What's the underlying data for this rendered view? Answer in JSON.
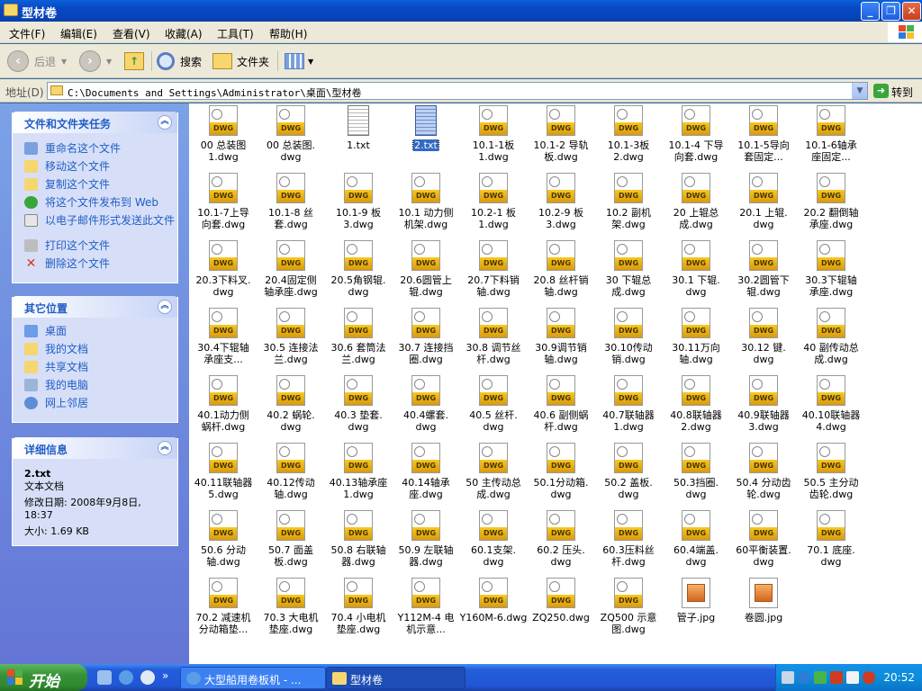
{
  "window": {
    "title": "型材卷",
    "buttons": {
      "minimize": "_",
      "maximize": "❐",
      "close": "✕"
    }
  },
  "menu": [
    "文件(F)",
    "编辑(E)",
    "查看(V)",
    "收藏(A)",
    "工具(T)",
    "帮助(H)"
  ],
  "toolbar": {
    "back": "后退",
    "search": "搜索",
    "folders": "文件夹"
  },
  "address": {
    "label": "地址(D)",
    "path": "C:\\Documents and Settings\\Administrator\\桌面\\型材卷",
    "go": "转到"
  },
  "panels": {
    "tasks": {
      "title": "文件和文件夹任务",
      "items": [
        "重命名这个文件",
        "移动这个文件",
        "复制这个文件",
        "将这个文件发布到 Web",
        "以电子邮件形式发送此文件",
        "打印这个文件",
        "删除这个文件"
      ]
    },
    "places": {
      "title": "其它位置",
      "items": [
        "桌面",
        "我的文档",
        "共享文档",
        "我的电脑",
        "网上邻居"
      ]
    },
    "details": {
      "title": "详细信息",
      "name": "2.txt",
      "type": "文本文档",
      "modified": "修改日期: 2008年9月8日, 18:37",
      "size": "大小: 1.69 KB"
    }
  },
  "files": [
    {
      "name": "00 总装图\n1.dwg",
      "type": "dwg"
    },
    {
      "name": "00 总装图.\ndwg",
      "type": "dwg"
    },
    {
      "name": "1.txt",
      "type": "txt"
    },
    {
      "name": "2.txt",
      "type": "txt",
      "selected": true
    },
    {
      "name": "10.1-1板\n1.dwg",
      "type": "dwg"
    },
    {
      "name": "10.1-2 导轨\n板.dwg",
      "type": "dwg"
    },
    {
      "name": "10.1-3板\n2.dwg",
      "type": "dwg"
    },
    {
      "name": "10.1-4 下导\n向套.dwg",
      "type": "dwg"
    },
    {
      "name": "10.1-5导向\n套固定...",
      "type": "dwg"
    },
    {
      "name": "10.1-6轴承\n座固定...",
      "type": "dwg"
    },
    {
      "name": "10.1-7上导\n向套.dwg",
      "type": "dwg"
    },
    {
      "name": "10.1-8 丝\n套.dwg",
      "type": "dwg"
    },
    {
      "name": "10.1-9 板\n3.dwg",
      "type": "dwg"
    },
    {
      "name": "10.1 动力侧\n机架.dwg",
      "type": "dwg"
    },
    {
      "name": "10.2-1 板\n1.dwg",
      "type": "dwg"
    },
    {
      "name": "10.2-9 板\n3.dwg",
      "type": "dwg"
    },
    {
      "name": "10.2 副机\n架.dwg",
      "type": "dwg"
    },
    {
      "name": "20 上辊总\n成.dwg",
      "type": "dwg"
    },
    {
      "name": "20.1 上辊.\ndwg",
      "type": "dwg"
    },
    {
      "name": "20.2 翻倒轴\n承座.dwg",
      "type": "dwg"
    },
    {
      "name": "20.3下料叉.\ndwg",
      "type": "dwg"
    },
    {
      "name": "20.4固定侧\n轴承座.dwg",
      "type": "dwg"
    },
    {
      "name": "20.5角钢辊.\ndwg",
      "type": "dwg"
    },
    {
      "name": "20.6圆管上\n辊.dwg",
      "type": "dwg"
    },
    {
      "name": "20.7下料销\n轴.dwg",
      "type": "dwg"
    },
    {
      "name": "20.8 丝杆销\n轴.dwg",
      "type": "dwg"
    },
    {
      "name": "30 下辊总\n成.dwg",
      "type": "dwg"
    },
    {
      "name": "30.1 下辊.\ndwg",
      "type": "dwg"
    },
    {
      "name": "30.2圆管下\n辊.dwg",
      "type": "dwg"
    },
    {
      "name": "30.3下辊轴\n承座.dwg",
      "type": "dwg"
    },
    {
      "name": "30.4下辊轴\n承座支...",
      "type": "dwg"
    },
    {
      "name": "30.5 连接法\n兰.dwg",
      "type": "dwg"
    },
    {
      "name": "30.6 套筒法\n兰.dwg",
      "type": "dwg"
    },
    {
      "name": "30.7 连接挡\n圈.dwg",
      "type": "dwg"
    },
    {
      "name": "30.8 调节丝\n杆.dwg",
      "type": "dwg"
    },
    {
      "name": "30.9调节销\n轴.dwg",
      "type": "dwg"
    },
    {
      "name": "30.10传动\n销.dwg",
      "type": "dwg"
    },
    {
      "name": "30.11万向\n轴.dwg",
      "type": "dwg"
    },
    {
      "name": "30.12 键.\ndwg",
      "type": "dwg"
    },
    {
      "name": "40 副传动总\n成.dwg",
      "type": "dwg"
    },
    {
      "name": "40.1动力侧\n蜗杆.dwg",
      "type": "dwg"
    },
    {
      "name": "40.2 蜗轮.\ndwg",
      "type": "dwg"
    },
    {
      "name": "40.3 垫套.\ndwg",
      "type": "dwg"
    },
    {
      "name": "40.4螺套.\ndwg",
      "type": "dwg"
    },
    {
      "name": "40.5 丝杆.\ndwg",
      "type": "dwg"
    },
    {
      "name": "40.6 副侧蜗\n杆.dwg",
      "type": "dwg"
    },
    {
      "name": "40.7联轴器\n1.dwg",
      "type": "dwg"
    },
    {
      "name": "40.8联轴器\n2.dwg",
      "type": "dwg"
    },
    {
      "name": "40.9联轴器\n3.dwg",
      "type": "dwg"
    },
    {
      "name": "40.10联轴器\n4.dwg",
      "type": "dwg"
    },
    {
      "name": "40.11联轴器\n5.dwg",
      "type": "dwg"
    },
    {
      "name": "40.12传动\n轴.dwg",
      "type": "dwg"
    },
    {
      "name": "40.13轴承座\n1.dwg",
      "type": "dwg"
    },
    {
      "name": "40.14轴承\n座.dwg",
      "type": "dwg"
    },
    {
      "name": "50 主传动总\n成.dwg",
      "type": "dwg"
    },
    {
      "name": "50.1分动箱.\ndwg",
      "type": "dwg"
    },
    {
      "name": "50.2 盖板.\ndwg",
      "type": "dwg"
    },
    {
      "name": "50.3挡圈.\ndwg",
      "type": "dwg"
    },
    {
      "name": "50.4 分动齿\n轮.dwg",
      "type": "dwg"
    },
    {
      "name": "50.5 主分动\n齿轮.dwg",
      "type": "dwg"
    },
    {
      "name": "50.6 分动\n轴.dwg",
      "type": "dwg"
    },
    {
      "name": "50.7 面盖\n板.dwg",
      "type": "dwg"
    },
    {
      "name": "50.8 右联轴\n器.dwg",
      "type": "dwg"
    },
    {
      "name": "50.9 左联轴\n器.dwg",
      "type": "dwg"
    },
    {
      "name": "60.1支架.\ndwg",
      "type": "dwg"
    },
    {
      "name": "60.2 压头.\ndwg",
      "type": "dwg"
    },
    {
      "name": "60.3压料丝\n杆.dwg",
      "type": "dwg"
    },
    {
      "name": "60.4端盖.\ndwg",
      "type": "dwg"
    },
    {
      "name": "60平衡装置.\ndwg",
      "type": "dwg"
    },
    {
      "name": "70.1 底座.\ndwg",
      "type": "dwg"
    },
    {
      "name": "70.2 减速机\n分动箱垫...",
      "type": "dwg"
    },
    {
      "name": "70.3 大电机\n垫座.dwg",
      "type": "dwg"
    },
    {
      "name": "70.4 小电机\n垫座.dwg",
      "type": "dwg"
    },
    {
      "name": "Y112M-4 电\n机示意...",
      "type": "dwg"
    },
    {
      "name": "Y160M-6.dwg",
      "type": "dwg"
    },
    {
      "name": "ZQ250.dwg",
      "type": "dwg"
    },
    {
      "name": "ZQ500 示意\n图.dwg",
      "type": "dwg"
    },
    {
      "name": "管子.jpg",
      "type": "jpg"
    },
    {
      "name": "卷圆.jpg",
      "type": "jpg"
    }
  ],
  "taskbar": {
    "start": "开始",
    "windows": [
      "大型船用卷板机 - ...",
      "型材卷"
    ],
    "clock": "20:52"
  },
  "colors": {
    "title_blue": "#0a5fd8",
    "panel_link": "#215dc6",
    "selection": "#316ac5",
    "start_green": "#379237"
  }
}
